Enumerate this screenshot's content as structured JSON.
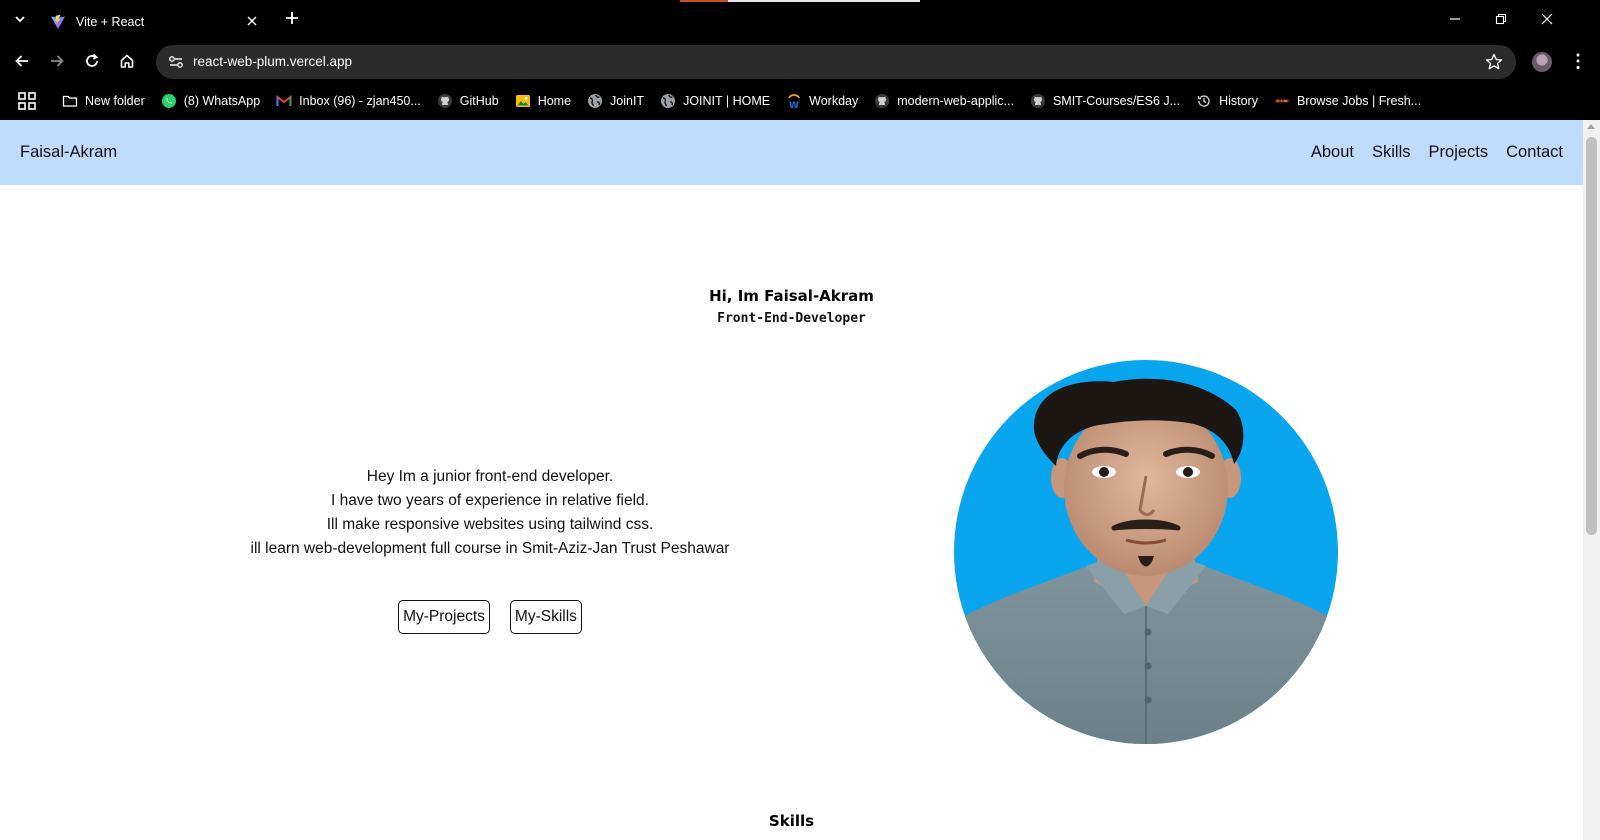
{
  "browser": {
    "tab_title": "Vite + React",
    "url": "react-web-plum.vercel.app",
    "bookmarks": [
      {
        "label": "New folder",
        "icon": "folder-icon"
      },
      {
        "label": "(8) WhatsApp",
        "icon": "whatsapp-icon"
      },
      {
        "label": "Inbox (96) - zjan450...",
        "icon": "gmail-icon"
      },
      {
        "label": "GitHub",
        "icon": "github-icon"
      },
      {
        "label": "Home",
        "icon": "image-icon"
      },
      {
        "label": "JoinIT",
        "icon": "globe-icon"
      },
      {
        "label": "JOINIT | HOME",
        "icon": "globe-icon"
      },
      {
        "label": "Workday",
        "icon": "workday-icon"
      },
      {
        "label": "modern-web-applic...",
        "icon": "github-icon"
      },
      {
        "label": "SMIT-Courses/ES6 J...",
        "icon": "github-icon"
      },
      {
        "label": "History",
        "icon": "history-icon"
      },
      {
        "label": "Browse Jobs | Fresh...",
        "icon": "jobs-icon"
      }
    ]
  },
  "site": {
    "brand": "Faisal-Akram",
    "nav": [
      "About",
      "Skills",
      "Projects",
      "Contact"
    ],
    "nav_color": "#bfdbfe"
  },
  "hero": {
    "name": "Hi, Im Faisal-Akram",
    "role": "Front-End-Developer",
    "intro": [
      "Hey Im a junior front-end developer.",
      "I have two years of experience in relative field.",
      "Ill make responsive websites using tailwind css.",
      "ill learn web-development full course in Smit-Aziz-Jan Trust Peshawar"
    ],
    "buttons": {
      "projects": "My-Projects",
      "skills": "My-Skills"
    },
    "photo_background": "#0aa5ef"
  },
  "skills": {
    "heading": "Skills"
  }
}
